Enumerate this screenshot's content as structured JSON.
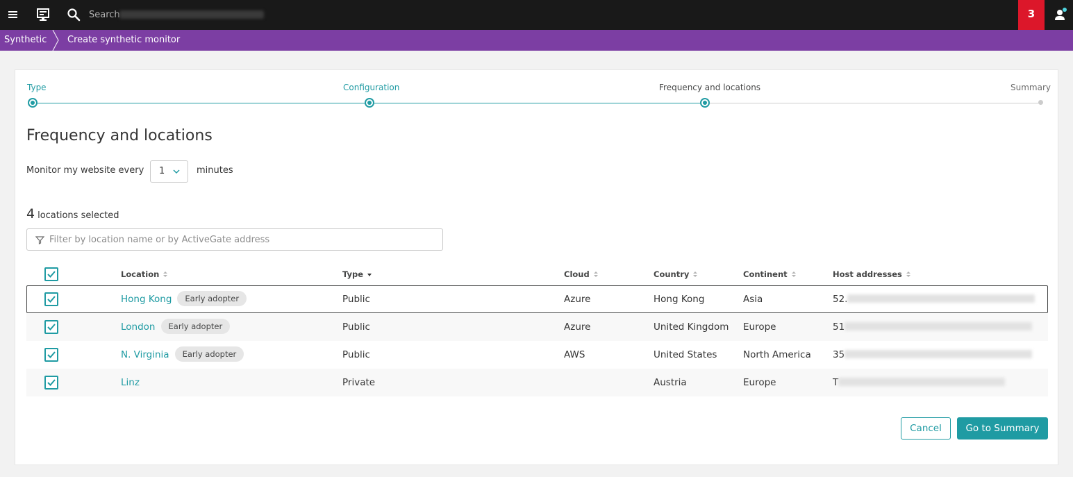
{
  "topbar": {
    "search_placeholder": "Search",
    "problems_count": "3"
  },
  "breadcrumb": {
    "items": [
      "Synthetic",
      "Create synthetic monitor"
    ]
  },
  "stepper": {
    "steps": [
      {
        "label": "Type",
        "state": "done"
      },
      {
        "label": "Configuration",
        "state": "done"
      },
      {
        "label": "Frequency and locations",
        "state": "active"
      },
      {
        "label": "Summary",
        "state": "todo"
      }
    ]
  },
  "page": {
    "title": "Frequency and locations",
    "frequency_label": "Monitor my website every",
    "frequency_value": "1",
    "frequency_unit": "minutes",
    "selected_count": "4",
    "selected_suffix": "locations selected",
    "filter_placeholder": "Filter by location name or by ActiveGate address"
  },
  "table": {
    "columns": [
      "Location",
      "Type",
      "Cloud",
      "Country",
      "Continent",
      "Host addresses"
    ],
    "rows": [
      {
        "location": "Hong Kong",
        "badge": "Early adopter",
        "type": "Public",
        "cloud": "Azure",
        "country": "Hong Kong",
        "continent": "Asia",
        "host_prefix": "52."
      },
      {
        "location": "London",
        "badge": "Early adopter",
        "type": "Public",
        "cloud": "Azure",
        "country": "United Kingdom",
        "continent": "Europe",
        "host_prefix": "51"
      },
      {
        "location": "N. Virginia",
        "badge": "Early adopter",
        "type": "Public",
        "cloud": "AWS",
        "country": "United States",
        "continent": "North America",
        "host_prefix": "35"
      },
      {
        "location": "Linz",
        "badge": "",
        "type": "Private",
        "cloud": "",
        "country": "Austria",
        "continent": "Europe",
        "host_prefix": "T"
      }
    ]
  },
  "buttons": {
    "cancel": "Cancel",
    "next": "Go to Summary"
  },
  "colors": {
    "accent": "#1f9ba3",
    "header": "#191919",
    "breadcrumb": "#7c3ea3",
    "alert": "#dc172a"
  }
}
